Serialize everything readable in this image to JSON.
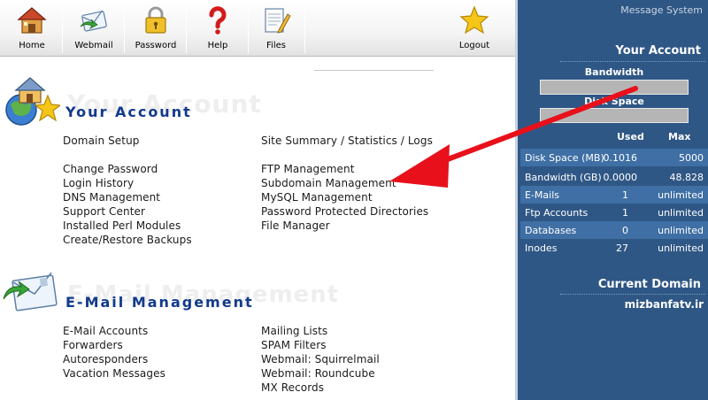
{
  "toolbar": {
    "home": "Home",
    "webmail": "Webmail",
    "password": "Password",
    "help": "Help",
    "files": "Files",
    "logout": "Logout"
  },
  "your_account": {
    "title": "Your Account",
    "links_left": [
      "Domain Setup",
      "Change Password",
      "Login History",
      "DNS Management",
      "Support Center",
      "Installed Perl Modules",
      "Create/Restore Backups"
    ],
    "links_right": [
      "Site Summary / Statistics / Logs",
      "FTP Management",
      "Subdomain Management",
      "MySQL Management",
      "Password Protected Directories",
      "File Manager"
    ]
  },
  "email": {
    "title": "E-Mail Management",
    "links_left": [
      "E-Mail Accounts",
      "Forwarders",
      "Autoresponders",
      "Vacation Messages"
    ],
    "links_right": [
      "Mailing Lists",
      "SPAM Filters",
      "Webmail: Squirrelmail",
      "Webmail: Roundcube",
      "MX Records"
    ]
  },
  "sidebar": {
    "message_system": "Message System",
    "heading": "Your Account",
    "bandwidth_label": "Bandwidth",
    "disk_label": "Disk Space",
    "col_used": "Used",
    "col_max": "Max",
    "rows": [
      {
        "label": "Disk Space (MB)",
        "used": "0.1016",
        "max": "5000"
      },
      {
        "label": "Bandwidth (GB)",
        "used": "0.0000",
        "max": "48.828"
      },
      {
        "label": "E-Mails",
        "used": "1",
        "max": "unlimited"
      },
      {
        "label": "Ftp Accounts",
        "used": "1",
        "max": "unlimited"
      },
      {
        "label": "Databases",
        "used": "0",
        "max": "unlimited"
      },
      {
        "label": "Inodes",
        "used": "27",
        "max": "unlimited"
      }
    ],
    "current_domain_heading": "Current Domain",
    "current_domain": "mizbanfatv.ir"
  },
  "colors": {
    "sidebar_bg": "#2f5785",
    "sidebar_alt_row": "#3f6fa4",
    "section_title": "#123a8c",
    "arrow": "#e8101a"
  }
}
